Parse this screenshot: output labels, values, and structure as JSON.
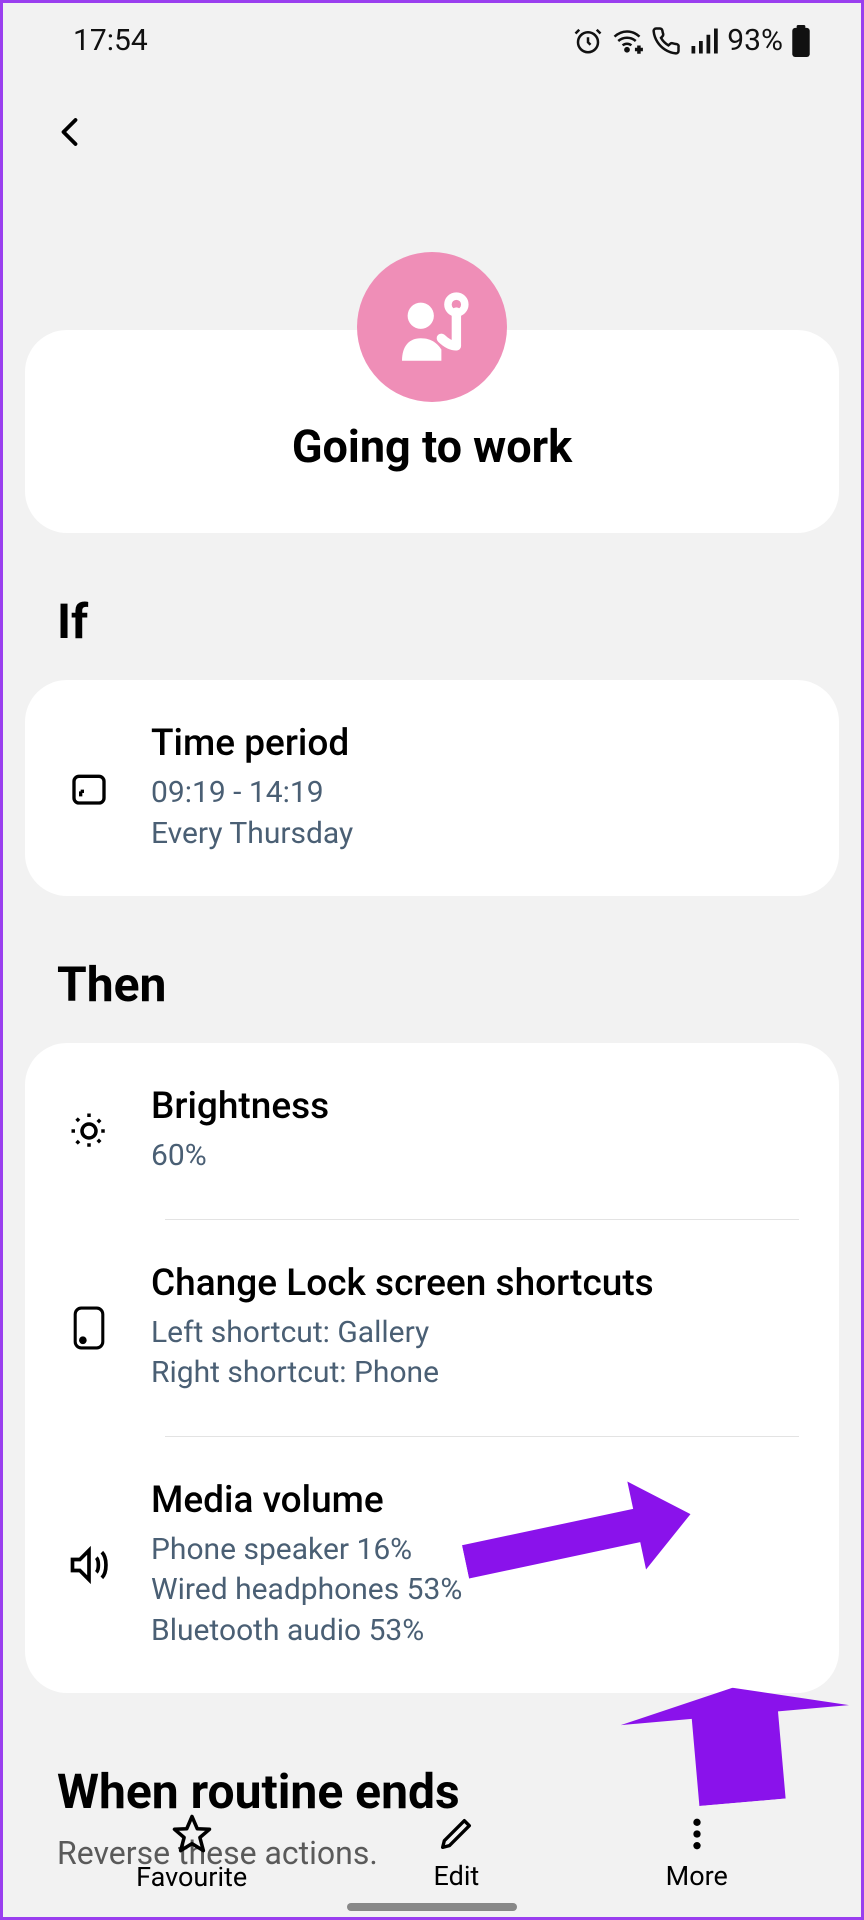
{
  "status": {
    "time": "17:54",
    "battery": "93%"
  },
  "routine": {
    "title": "Going to work"
  },
  "sections": {
    "if_label": "If",
    "then_label": "Then",
    "end_label": "When routine ends",
    "end_sub": "Reverse these actions."
  },
  "if_rows": [
    {
      "title": "Time period",
      "sub": "09:19 - 14:19\nEvery Thursday"
    }
  ],
  "then_rows": [
    {
      "title": "Brightness",
      "sub": "60%"
    },
    {
      "title": "Change Lock screen shortcuts",
      "sub": "Left shortcut: Gallery\nRight shortcut: Phone"
    },
    {
      "title": "Media volume",
      "sub": "Phone speaker 16%\nWired headphones 53%\nBluetooth audio 53%"
    }
  ],
  "bottom": {
    "favourite": "Favourite",
    "edit": "Edit",
    "more": "More"
  }
}
